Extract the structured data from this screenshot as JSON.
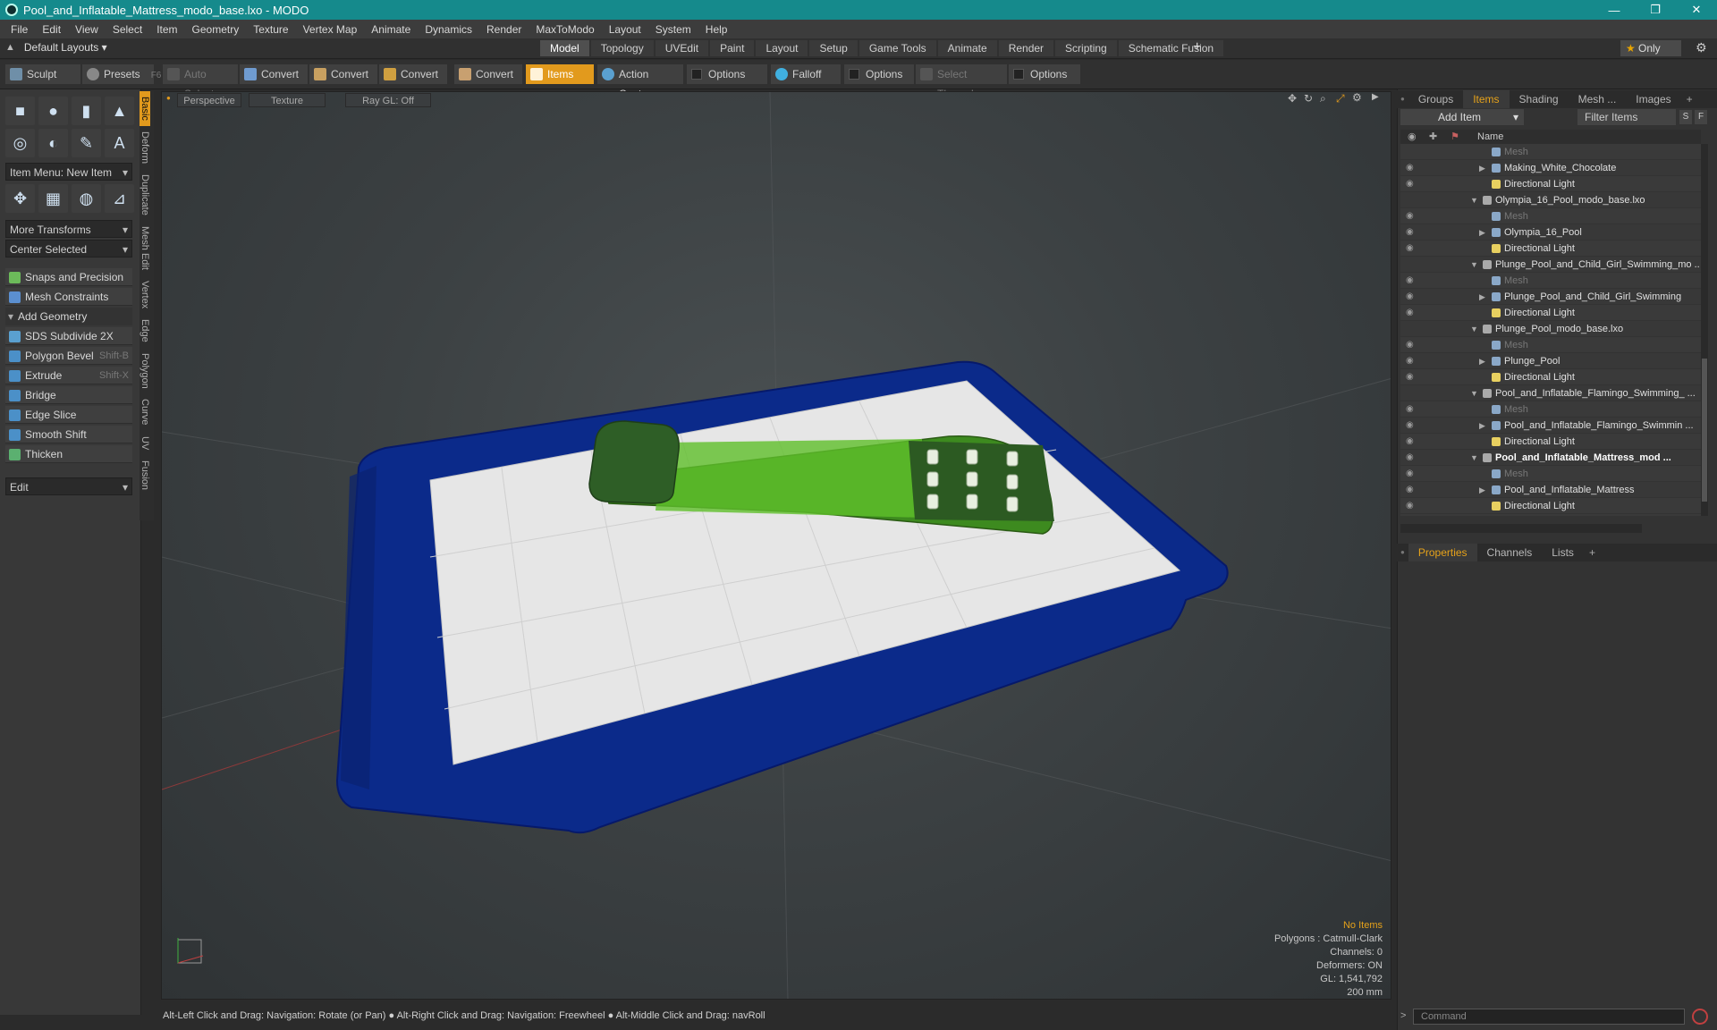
{
  "window": {
    "title": "Pool_and_Inflatable_Mattress_modo_base.lxo - MODO",
    "controls": [
      "—",
      "❐",
      "✕"
    ]
  },
  "menu": [
    "File",
    "Edit",
    "View",
    "Select",
    "Item",
    "Geometry",
    "Texture",
    "Vertex Map",
    "Animate",
    "Dynamics",
    "Render",
    "MaxToModo",
    "Layout",
    "System",
    "Help"
  ],
  "layoutbar": {
    "layouts_label": "Default Layouts",
    "tabs": [
      "Model",
      "Topology",
      "UVEdit",
      "Paint",
      "Layout",
      "Setup",
      "Game Tools",
      "Animate",
      "Render",
      "Scripting",
      "Schematic Fusion"
    ],
    "active_tab": "Model",
    "only_label": "Only"
  },
  "toolbar": {
    "sculpt": "Sculpt",
    "presets": "Presets",
    "presets_key": "F6",
    "auto_select": "Auto Select",
    "convert1": "Convert",
    "convert2": "Convert",
    "convert3": "Convert",
    "convert4": "Convert",
    "items": "Items",
    "action_center": "Action Center",
    "options1": "Options",
    "falloff": "Falloff",
    "options2": "Options",
    "select_through": "Select Through",
    "options3": "Options"
  },
  "leftpanel": {
    "vtabs": [
      "Basic",
      "Deform",
      "Duplicate",
      "Mesh Edit",
      "Vertex",
      "Edge",
      "Polygon",
      "Curve",
      "UV",
      "Fusion"
    ],
    "item_menu": "Item Menu: New Item",
    "more_transforms": "More Transforms",
    "center_selected": "Center Selected",
    "snaps": "Snaps and Precision",
    "mesh_constraints": "Mesh Constraints",
    "add_geometry": "Add Geometry",
    "tools": [
      {
        "label": "SDS Subdivide 2X",
        "shortcut": ""
      },
      {
        "label": "Polygon Bevel",
        "shortcut": "Shift-B"
      },
      {
        "label": "Extrude",
        "shortcut": "Shift-X"
      },
      {
        "label": "Bridge",
        "shortcut": ""
      },
      {
        "label": "Edge Slice",
        "shortcut": ""
      },
      {
        "label": "Smooth Shift",
        "shortcut": ""
      },
      {
        "label": "Thicken",
        "shortcut": ""
      }
    ],
    "edit": "Edit"
  },
  "viewport": {
    "perspective": "Perspective",
    "texture": "Texture",
    "raygl": "Ray GL: Off",
    "info": {
      "no_items": "No Items",
      "polygons": "Polygons : Catmull-Clark",
      "channels": "Channels: 0",
      "deformers": "Deformers: ON",
      "gl": "GL: 1,541,792",
      "scale": "200 mm"
    }
  },
  "rightpanel": {
    "tabs": [
      "Groups",
      "Items",
      "Shading",
      "Mesh ...",
      "Images"
    ],
    "active_tab": "Items",
    "add_item": "Add Item",
    "filter_items": "Filter Items",
    "filter_s": "S",
    "filter_f": "F",
    "name_col": "Name",
    "rows": [
      {
        "label": "Mesh",
        "level": 2,
        "kind": "mesh",
        "dim": true,
        "arrow": "",
        "bold": false,
        "eye": false
      },
      {
        "label": "Making_White_Chocolate",
        "level": 2,
        "kind": "mesh",
        "dim": false,
        "arrow": "▶",
        "bold": false,
        "eye": true
      },
      {
        "label": "Directional Light",
        "level": 2,
        "kind": "light",
        "dim": false,
        "arrow": "",
        "bold": false,
        "eye": true
      },
      {
        "label": "Olympia_16_Pool_modo_base.lxo",
        "level": 1,
        "kind": "scene",
        "dim": false,
        "arrow": "▼",
        "bold": false,
        "eye": false
      },
      {
        "label": "Mesh",
        "level": 2,
        "kind": "mesh",
        "dim": true,
        "arrow": "",
        "bold": false,
        "eye": true
      },
      {
        "label": "Olympia_16_Pool",
        "level": 2,
        "kind": "mesh",
        "dim": false,
        "arrow": "▶",
        "bold": false,
        "eye": true
      },
      {
        "label": "Directional Light",
        "level": 2,
        "kind": "light",
        "dim": false,
        "arrow": "",
        "bold": false,
        "eye": true
      },
      {
        "label": "Plunge_Pool_and_Child_Girl_Swimming_mo ...",
        "level": 1,
        "kind": "scene",
        "dim": false,
        "arrow": "▼",
        "bold": false,
        "eye": false
      },
      {
        "label": "Mesh",
        "level": 2,
        "kind": "mesh",
        "dim": true,
        "arrow": "",
        "bold": false,
        "eye": true
      },
      {
        "label": "Plunge_Pool_and_Child_Girl_Swimming",
        "level": 2,
        "kind": "mesh",
        "dim": false,
        "arrow": "▶",
        "bold": false,
        "eye": true
      },
      {
        "label": "Directional Light",
        "level": 2,
        "kind": "light",
        "dim": false,
        "arrow": "",
        "bold": false,
        "eye": true
      },
      {
        "label": "Plunge_Pool_modo_base.lxo",
        "level": 1,
        "kind": "scene",
        "dim": false,
        "arrow": "▼",
        "bold": false,
        "eye": false
      },
      {
        "label": "Mesh",
        "level": 2,
        "kind": "mesh",
        "dim": true,
        "arrow": "",
        "bold": false,
        "eye": true
      },
      {
        "label": "Plunge_Pool",
        "level": 2,
        "kind": "mesh",
        "dim": false,
        "arrow": "▶",
        "bold": false,
        "eye": true
      },
      {
        "label": "Directional Light",
        "level": 2,
        "kind": "light",
        "dim": false,
        "arrow": "",
        "bold": false,
        "eye": true
      },
      {
        "label": "Pool_and_Inflatable_Flamingo_Swimming_ ...",
        "level": 1,
        "kind": "scene",
        "dim": false,
        "arrow": "▼",
        "bold": false,
        "eye": false
      },
      {
        "label": "Mesh",
        "level": 2,
        "kind": "mesh",
        "dim": true,
        "arrow": "",
        "bold": false,
        "eye": true
      },
      {
        "label": "Pool_and_Inflatable_Flamingo_Swimmin ...",
        "level": 2,
        "kind": "mesh",
        "dim": false,
        "arrow": "▶",
        "bold": false,
        "eye": true
      },
      {
        "label": "Directional Light",
        "level": 2,
        "kind": "light",
        "dim": false,
        "arrow": "",
        "bold": false,
        "eye": true
      },
      {
        "label": "Pool_and_Inflatable_Mattress_mod ...",
        "level": 1,
        "kind": "scene",
        "dim": false,
        "arrow": "▼",
        "bold": true,
        "eye": true
      },
      {
        "label": "Mesh",
        "level": 2,
        "kind": "mesh",
        "dim": true,
        "arrow": "",
        "bold": false,
        "eye": true
      },
      {
        "label": "Pool_and_Inflatable_Mattress",
        "level": 2,
        "kind": "mesh",
        "dim": false,
        "arrow": "▶",
        "bold": false,
        "eye": true
      },
      {
        "label": "Directional Light",
        "level": 2,
        "kind": "light",
        "dim": false,
        "arrow": "",
        "bold": false,
        "eye": true
      }
    ],
    "props_tabs": [
      "Properties",
      "Channels",
      "Lists"
    ],
    "props_active": "Properties"
  },
  "status": {
    "hint": "Alt-Left Click and Drag: Navigation: Rotate (or Pan) ● Alt-Right Click and Drag: Navigation: Freewheel ● Alt-Middle Click and Drag: navRoll",
    "command_placeholder": "Command"
  },
  "colors": {
    "accent": "#e29a1d",
    "titlebar": "#158a8c",
    "pool_blue": "#0b2a8a",
    "mattress_green": "#3a8a1e"
  }
}
